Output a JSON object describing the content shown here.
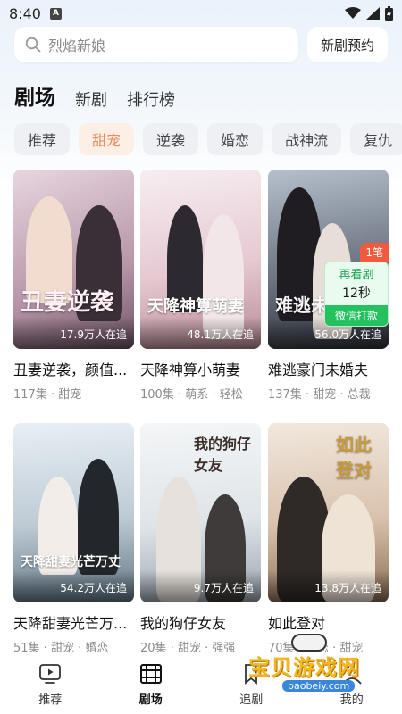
{
  "status_bar": {
    "time": "8:40",
    "notif_glyph": "A"
  },
  "search": {
    "placeholder": "烈焰新娘",
    "reserve_label": "新剧预约"
  },
  "main_tabs": [
    {
      "label": "剧场",
      "active": true
    },
    {
      "label": "新剧",
      "active": false
    },
    {
      "label": "排行榜",
      "active": false
    }
  ],
  "categories": [
    {
      "label": "推荐",
      "active": false
    },
    {
      "label": "甜宠",
      "active": true
    },
    {
      "label": "逆袭",
      "active": false
    },
    {
      "label": "婚恋",
      "active": false
    },
    {
      "label": "战神流",
      "active": false
    },
    {
      "label": "复仇",
      "active": false
    }
  ],
  "dramas": [
    {
      "title": "丑妻逆袭，颜值...",
      "followers": "17.9万人在追",
      "meta": "117集 · 甜宠",
      "poster_text": "丑妻逆袭",
      "colors": [
        "#d9c2cf",
        "#7b5f72"
      ]
    },
    {
      "title": "天降神算小萌妻",
      "followers": "48.1万人在追",
      "meta": "100集 · 萌系 · 轻松",
      "poster_text": "天降神算萌妻",
      "colors": [
        "#f3e4ea",
        "#9c6b78"
      ]
    },
    {
      "title": "难逃豪门未婚夫",
      "followers": "56.0万人在追",
      "meta": "137集 · 甜宠 · 总裁",
      "poster_text": "难逃未婚夫",
      "colors": [
        "#9aa6b8",
        "#3c3f4a"
      ]
    },
    {
      "title": "天降甜妻光芒万...",
      "followers": "54.2万人在追",
      "meta": "51集 · 甜宠 · 婚恋",
      "poster_text": "天降甜妻光芒万丈",
      "colors": [
        "#dfe9f0",
        "#6f8493"
      ]
    },
    {
      "title": "我的狗仔女友",
      "followers": "9.7万人在追",
      "meta": "20集 · 甜宠 · 强强",
      "poster_text": "我的狗仔女友",
      "colors": [
        "#eef1f3",
        "#7d8790"
      ]
    },
    {
      "title": "如此登对",
      "followers": "13.8万人在追",
      "meta": "70集 · 婚恋 · 甜宠",
      "poster_text": "如此登对",
      "colors": [
        "#e9ddcf",
        "#8a6c54"
      ]
    }
  ],
  "ad": {
    "badge": "1笔",
    "line1": "再看剧",
    "line2": "12秒",
    "button": "微信打款"
  },
  "bottom_nav": [
    {
      "label": "推荐",
      "icon": "play-screen-icon",
      "active": false
    },
    {
      "label": "剧场",
      "icon": "film-strip-icon",
      "active": true
    },
    {
      "label": "追剧",
      "icon": "bookmark-icon",
      "active": false
    },
    {
      "label": "我的",
      "icon": "user-icon",
      "active": false
    }
  ],
  "watermark": {
    "text": "宝贝游戏网",
    "url": "baobeiy.com"
  }
}
